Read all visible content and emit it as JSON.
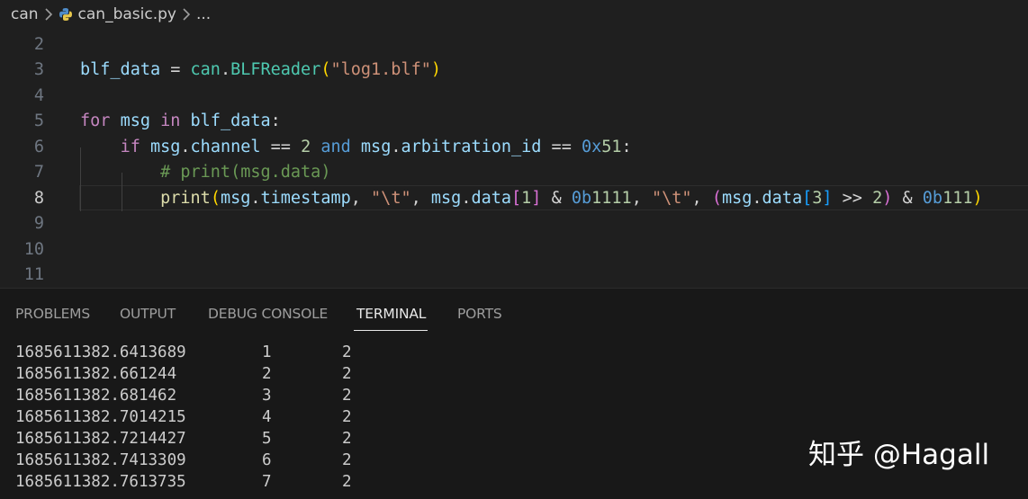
{
  "breadcrumb": {
    "folder": "can",
    "file": "can_basic.py",
    "more": "..."
  },
  "editor": {
    "lines": [
      {
        "number": "2",
        "active": false,
        "tokens": []
      },
      {
        "number": "3",
        "active": false,
        "tokens": [
          {
            "t": "blf_data",
            "c": "var"
          },
          {
            "t": " = ",
            "c": "op"
          },
          {
            "t": "can",
            "c": "mod"
          },
          {
            "t": ".",
            "c": "op"
          },
          {
            "t": "BLFReader",
            "c": "mod"
          },
          {
            "t": "(",
            "c": "p1"
          },
          {
            "t": "\"log1.blf\"",
            "c": "str"
          },
          {
            "t": ")",
            "c": "p1"
          }
        ]
      },
      {
        "number": "4",
        "active": false,
        "tokens": []
      },
      {
        "number": "5",
        "active": false,
        "tokens": [
          {
            "t": "for",
            "c": "kw"
          },
          {
            "t": " ",
            "c": "op"
          },
          {
            "t": "msg",
            "c": "var"
          },
          {
            "t": " ",
            "c": "op"
          },
          {
            "t": "in",
            "c": "kw"
          },
          {
            "t": " ",
            "c": "op"
          },
          {
            "t": "blf_data",
            "c": "var"
          },
          {
            "t": ":",
            "c": "op"
          }
        ]
      },
      {
        "number": "6",
        "active": false,
        "tokens": [
          {
            "t": "    ",
            "c": "op"
          },
          {
            "t": "if",
            "c": "kw"
          },
          {
            "t": " ",
            "c": "op"
          },
          {
            "t": "msg",
            "c": "var"
          },
          {
            "t": ".",
            "c": "op"
          },
          {
            "t": "channel",
            "c": "var"
          },
          {
            "t": " == ",
            "c": "op"
          },
          {
            "t": "2",
            "c": "num"
          },
          {
            "t": " ",
            "c": "op"
          },
          {
            "t": "and",
            "c": "kw2"
          },
          {
            "t": " ",
            "c": "op"
          },
          {
            "t": "msg",
            "c": "var"
          },
          {
            "t": ".",
            "c": "op"
          },
          {
            "t": "arbitration_id",
            "c": "var"
          },
          {
            "t": " == ",
            "c": "op"
          },
          {
            "t": "0x",
            "c": "kw2"
          },
          {
            "t": "51",
            "c": "num"
          },
          {
            "t": ":",
            "c": "op"
          }
        ]
      },
      {
        "number": "7",
        "active": false,
        "tokens": [
          {
            "t": "        ",
            "c": "op"
          },
          {
            "t": "# print(msg.data)",
            "c": "cm"
          }
        ]
      },
      {
        "number": "8",
        "active": true,
        "tokens": [
          {
            "t": "        ",
            "c": "op"
          },
          {
            "t": "print",
            "c": "fn"
          },
          {
            "t": "(",
            "c": "p1"
          },
          {
            "t": "msg",
            "c": "var"
          },
          {
            "t": ".",
            "c": "op"
          },
          {
            "t": "timestamp",
            "c": "var"
          },
          {
            "t": ", ",
            "c": "op"
          },
          {
            "t": "\"\\t\"",
            "c": "str"
          },
          {
            "t": ", ",
            "c": "op"
          },
          {
            "t": "msg",
            "c": "var"
          },
          {
            "t": ".",
            "c": "op"
          },
          {
            "t": "data",
            "c": "var"
          },
          {
            "t": "[",
            "c": "p2"
          },
          {
            "t": "1",
            "c": "num"
          },
          {
            "t": "]",
            "c": "p2"
          },
          {
            "t": " & ",
            "c": "op"
          },
          {
            "t": "0b",
            "c": "kw2"
          },
          {
            "t": "1111",
            "c": "num"
          },
          {
            "t": ", ",
            "c": "op"
          },
          {
            "t": "\"\\t\"",
            "c": "str"
          },
          {
            "t": ", ",
            "c": "op"
          },
          {
            "t": "(",
            "c": "p2"
          },
          {
            "t": "msg",
            "c": "var"
          },
          {
            "t": ".",
            "c": "op"
          },
          {
            "t": "data",
            "c": "var"
          },
          {
            "t": "[",
            "c": "p3"
          },
          {
            "t": "3",
            "c": "num"
          },
          {
            "t": "]",
            "c": "p3"
          },
          {
            "t": " >> ",
            "c": "op"
          },
          {
            "t": "2",
            "c": "num"
          },
          {
            "t": ")",
            "c": "p2"
          },
          {
            "t": " & ",
            "c": "op"
          },
          {
            "t": "0b",
            "c": "kw2"
          },
          {
            "t": "111",
            "c": "num"
          },
          {
            "t": ")",
            "c": "p1"
          }
        ]
      },
      {
        "number": "9",
        "active": false,
        "tokens": []
      },
      {
        "number": "10",
        "active": false,
        "tokens": []
      },
      {
        "number": "11",
        "active": false,
        "tokens": []
      }
    ]
  },
  "panel": {
    "tabs": [
      {
        "label": "PROBLEMS",
        "active": false
      },
      {
        "label": "OUTPUT",
        "active": false
      },
      {
        "label": "DEBUG CONSOLE",
        "active": false
      },
      {
        "label": "TERMINAL",
        "active": true
      },
      {
        "label": "PORTS",
        "active": false
      }
    ],
    "terminal_rows": [
      {
        "timestamp": "1685611382.6413689",
        "a": "1",
        "b": "2"
      },
      {
        "timestamp": "1685611382.661244",
        "a": "2",
        "b": "2"
      },
      {
        "timestamp": "1685611382.681462",
        "a": "3",
        "b": "2"
      },
      {
        "timestamp": "1685611382.7014215",
        "a": "4",
        "b": "2"
      },
      {
        "timestamp": "1685611382.7214427",
        "a": "5",
        "b": "2"
      },
      {
        "timestamp": "1685611382.7413309",
        "a": "6",
        "b": "2"
      },
      {
        "timestamp": "1685611382.7613735",
        "a": "7",
        "b": "2"
      }
    ]
  },
  "watermark": "知乎 @Hagall",
  "colors": {
    "var": "#9cdcfe",
    "keyword": "#c586c0",
    "constant_prefix": "#569cd6",
    "module": "#4ec9b0",
    "function": "#dcdcaa",
    "string": "#ce9178",
    "number": "#b5cea8",
    "comment": "#6a9955"
  }
}
